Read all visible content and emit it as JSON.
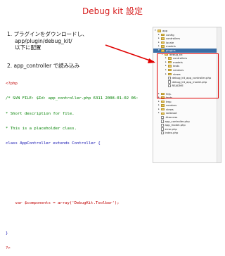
{
  "title": "Debug kit  設定",
  "steps": [
    {
      "number": "1.",
      "text": "プラグインをダウンロードし、",
      "lines": [
        "app/plugin/debug_kit/",
        "以下に配置"
      ]
    },
    {
      "number": "2.",
      "text": "app_controller で読み込み"
    }
  ],
  "code": {
    "lines": [
      "<?php",
      "/* SVN FILE: $Id: app_controller.php 6311 2008-01-02 06:",
      "* Short description for file.",
      "* This is a placeholder class.",
      "class AppController extends Controller {",
      "",
      "",
      "",
      "    var $components = array('DebugKit.Toolbar');",
      "",
      "}",
      "?>"
    ]
  },
  "file_tree": {
    "items": [
      {
        "label": "app",
        "depth": 0,
        "type": "folder",
        "toggle": "▾"
      },
      {
        "label": "config",
        "depth": 1,
        "type": "folder",
        "toggle": "▸"
      },
      {
        "label": "controllers",
        "depth": 1,
        "type": "folder",
        "toggle": "▸"
      },
      {
        "label": "locale",
        "depth": 1,
        "type": "folder",
        "toggle": "▸"
      },
      {
        "label": "models",
        "depth": 1,
        "type": "folder",
        "toggle": "▸"
      },
      {
        "label": "plugins",
        "depth": 1,
        "type": "folder",
        "toggle": "▾",
        "selected": true
      },
      {
        "label": "debug_kit",
        "depth": 2,
        "type": "folder",
        "toggle": "▾"
      },
      {
        "label": "controllers",
        "depth": 3,
        "type": "folder",
        "toggle": "▸"
      },
      {
        "label": "models",
        "depth": 3,
        "type": "folder",
        "toggle": "▸"
      },
      {
        "label": "tests",
        "depth": 3,
        "type": "folder",
        "toggle": "▸"
      },
      {
        "label": "vendors",
        "depth": 3,
        "type": "folder",
        "toggle": "▸"
      },
      {
        "label": "views",
        "depth": 3,
        "type": "folder",
        "toggle": "▸"
      },
      {
        "label": "debug_kit_app_controller.php",
        "depth": 3,
        "type": "file",
        "toggle": ""
      },
      {
        "label": "debug_kit_app_model.php",
        "depth": 3,
        "type": "file",
        "toggle": ""
      },
      {
        "label": "README",
        "depth": 3,
        "type": "file",
        "toggle": ""
      },
      {
        "label": "",
        "depth": 1,
        "type": "blank",
        "toggle": ""
      },
      {
        "label": "SQL",
        "depth": 1,
        "type": "folder",
        "toggle": "▸"
      },
      {
        "label": "tests",
        "depth": 1,
        "type": "folder",
        "toggle": "▸"
      },
      {
        "label": "tmp",
        "depth": 1,
        "type": "folder",
        "toggle": "▸"
      },
      {
        "label": "vendors",
        "depth": 1,
        "type": "folder",
        "toggle": "▸"
      },
      {
        "label": "views",
        "depth": 1,
        "type": "folder",
        "toggle": "▸"
      },
      {
        "label": "webroot",
        "depth": 1,
        "type": "folder",
        "toggle": "▸"
      },
      {
        "label": ".htaccess",
        "depth": 1,
        "type": "file",
        "toggle": ""
      },
      {
        "label": "app_controller.php",
        "depth": 1,
        "type": "file",
        "toggle": ""
      },
      {
        "label": "app_model.php",
        "depth": 1,
        "type": "file",
        "toggle": ""
      },
      {
        "label": "error.php",
        "depth": 1,
        "type": "file",
        "toggle": ""
      },
      {
        "label": "index.php",
        "depth": 1,
        "type": "file",
        "toggle": ""
      }
    ]
  },
  "colors": {
    "title": "#d71f1f",
    "highlight": "#e00000",
    "selection": "#3b6ea5",
    "folder": "#e7c45a"
  },
  "icons": [
    "folder-icon",
    "file-icon",
    "arrow-icon"
  ]
}
